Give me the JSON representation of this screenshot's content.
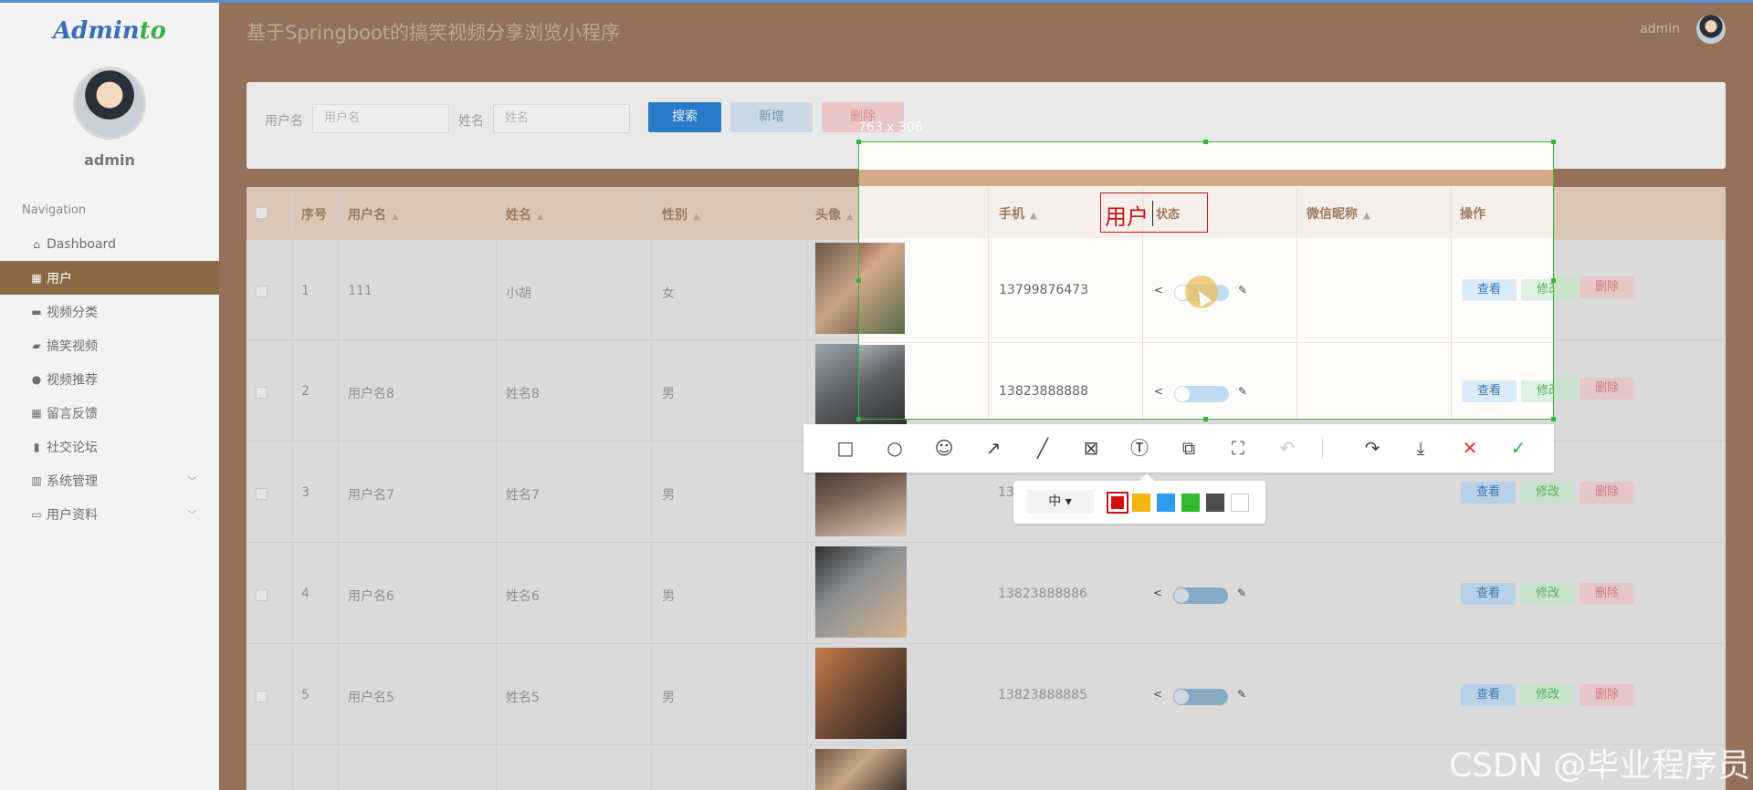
{
  "app": {
    "logo_main": "Admin",
    "logo_accent": "to",
    "admin_name": "admin",
    "page_title": "基于Springboot的搞笑视频分享浏览小程序",
    "header_user": "admin"
  },
  "sidebar": {
    "nav_title": "Navigation",
    "items": [
      {
        "label": "Dashboard",
        "icon": "home-icon"
      },
      {
        "label": "用户",
        "icon": "grid-icon"
      },
      {
        "label": "视频分类",
        "icon": "video-icon"
      },
      {
        "label": "搞笑视频",
        "icon": "ticket-icon"
      },
      {
        "label": "视频推荐",
        "icon": "person-icon"
      },
      {
        "label": "留言反馈",
        "icon": "grid-icon"
      },
      {
        "label": "社交论坛",
        "icon": "clipboard-icon"
      },
      {
        "label": "系统管理",
        "icon": "bar-chart-icon"
      },
      {
        "label": "用户资料",
        "icon": "card-icon"
      }
    ]
  },
  "search": {
    "username_label": "用户名",
    "username_placeholder": "用户名",
    "name_label": "姓名",
    "name_placeholder": "姓名",
    "search_btn": "搜索",
    "add_btn": "新增",
    "delete_btn": "删除"
  },
  "table": {
    "headers": [
      "序号",
      "用户名",
      "姓名",
      "性别",
      "头像",
      "手机",
      "状态",
      "微信昵称",
      "操作"
    ],
    "actions": {
      "view": "查看",
      "edit": "修改",
      "delete": "删除"
    },
    "rows": [
      {
        "no": "1",
        "username": "111",
        "name": "小胡",
        "gender": "女",
        "phone": "13799876473"
      },
      {
        "no": "2",
        "username": "用户名8",
        "name": "姓名8",
        "gender": "男",
        "phone": "13823888888"
      },
      {
        "no": "3",
        "username": "用户名7",
        "name": "姓名7",
        "gender": "男",
        "phone": "13"
      },
      {
        "no": "4",
        "username": "用户名6",
        "name": "姓名6",
        "gender": "男",
        "phone": "13823888886"
      },
      {
        "no": "5",
        "username": "用户名5",
        "name": "姓名5",
        "gender": "男",
        "phone": "13823888885"
      }
    ]
  },
  "screenshot_tool": {
    "selection_size": "763 x 306",
    "text_annotation": "用户",
    "size_option": "中",
    "colors": [
      "#d01010",
      "#f3b40d",
      "#2d9cf0",
      "#2fba2f",
      "#4d4d4d",
      "#ffffff"
    ],
    "tools": [
      "rectangle-icon",
      "circle-icon",
      "emoji-icon",
      "arrow-icon",
      "pen-icon",
      "mosaic-icon",
      "text-icon",
      "pin-icon",
      "ocr-icon",
      "undo-icon",
      "share-icon",
      "download-icon",
      "cancel-icon",
      "confirm-icon"
    ]
  },
  "watermark": "CSDN @毕业程序员"
}
